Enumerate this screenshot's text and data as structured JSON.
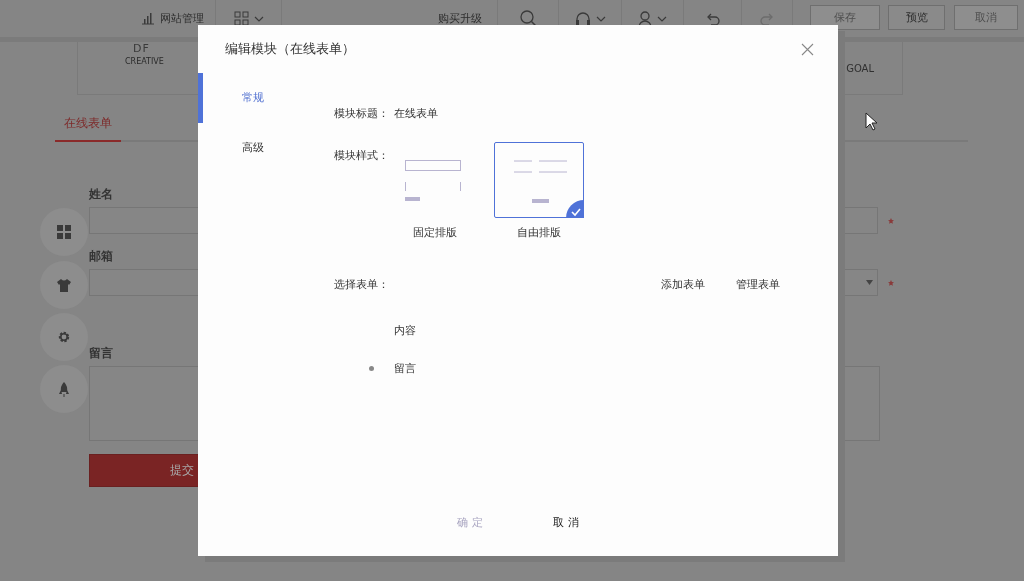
{
  "toolbar": {
    "site_manage": "网站管理",
    "buy_upgrade": "购买升级",
    "buttons": [
      {
        "label": "保存",
        "disabled": true
      },
      {
        "label": "预览",
        "disabled": false
      },
      {
        "label": "取消",
        "disabled": true
      }
    ]
  },
  "page": {
    "logo_left": {
      "mark": "DF",
      "caption": "CREATIVE"
    },
    "logo_right": "GOAL",
    "tab": "在线表单",
    "fields": [
      {
        "label": "姓名",
        "kind": "input",
        "required": true
      },
      {
        "label": "邮箱",
        "kind": "select",
        "required": true
      },
      {
        "label": "留言",
        "kind": "textarea",
        "required": false
      }
    ],
    "submit": "提交"
  },
  "dialog": {
    "title": "编辑模块（在线表单）",
    "nav": [
      {
        "label": "常规",
        "selected": true
      },
      {
        "label": "高级",
        "selected": false
      }
    ],
    "module_title": {
      "label": "模块标题：",
      "value": "在线表单"
    },
    "module_style": {
      "label": "模块样式：",
      "options": [
        {
          "label": "固定排版",
          "kind": "fixed",
          "selected": false
        },
        {
          "label": "自由排版",
          "kind": "free",
          "selected": true
        }
      ]
    },
    "select_form": {
      "label": "选择表单：",
      "actions": [
        "添加表单",
        "管理表单"
      ]
    },
    "form_fields": [
      {
        "label": "内容",
        "checked": false
      },
      {
        "label": "留言",
        "checked": true
      }
    ],
    "footer": [
      {
        "label": "确 定",
        "disabled": true
      },
      {
        "label": "取 消",
        "disabled": false
      }
    ]
  }
}
